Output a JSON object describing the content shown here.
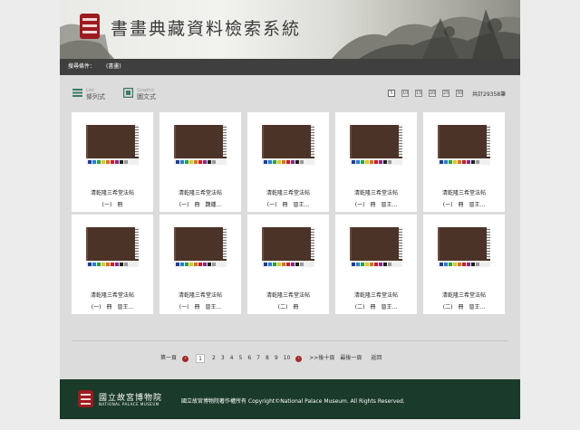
{
  "header": {
    "title": "書畫典藏資料檢索系統"
  },
  "search_condition": {
    "label": "搜尋條件：",
    "value": "(書畫)"
  },
  "toolbar": {
    "list_view": {
      "title": "List",
      "subtitle": "條列式"
    },
    "graphic_view": {
      "title": "Graphic",
      "subtitle": "圖文式"
    },
    "page_sizes": [
      "5",
      "10",
      "15",
      "20",
      "25",
      "30"
    ],
    "active_size": "5",
    "total": "共計29358筆"
  },
  "results": [
    {
      "title": "清乾隆三希堂法帖",
      "meta": [
        "(一)",
        "冊",
        ""
      ]
    },
    {
      "title": "清乾隆三希堂法帖",
      "meta": [
        "(一)",
        "冊",
        "魏鍾..."
      ]
    },
    {
      "title": "清乾隆三希堂法帖",
      "meta": [
        "(一)",
        "冊",
        "晉王..."
      ]
    },
    {
      "title": "清乾隆三希堂法帖",
      "meta": [
        "(一)",
        "冊",
        "晉王..."
      ]
    },
    {
      "title": "清乾隆三希堂法帖",
      "meta": [
        "(一)",
        "冊",
        "晉王..."
      ]
    },
    {
      "title": "清乾隆三希堂法帖",
      "meta": [
        "(一)",
        "冊",
        "晉王..."
      ]
    },
    {
      "title": "清乾隆三希堂法帖",
      "meta": [
        "(一)",
        "冊",
        "晉王..."
      ]
    },
    {
      "title": "清乾隆三希堂法帖",
      "meta": [
        "(二)",
        "冊",
        ""
      ]
    },
    {
      "title": "清乾隆三希堂法帖",
      "meta": [
        "(二)",
        "冊",
        "晉王..."
      ]
    },
    {
      "title": "清乾隆三希堂法帖",
      "meta": [
        "(二)",
        "冊",
        "晉王..."
      ]
    }
  ],
  "swatch_colors": [
    "#1f3f8f",
    "#2a7fd0",
    "#2aa14a",
    "#e6c61a",
    "#d9731c",
    "#c81f2a",
    "#8a2a8a",
    "#222222",
    "#999999"
  ],
  "pagination": {
    "first": "第一頁",
    "pages": [
      "1",
      "2",
      "3",
      "4",
      "5",
      "6",
      "7",
      "8",
      "9",
      "10"
    ],
    "current": "1",
    "next_ten": ">>後十頁",
    "last": "最後一頁",
    "back": "返回",
    "prev_icon": "‹",
    "next_icon": "›"
  },
  "footer": {
    "name_zh": "國立故宮博物院",
    "name_en": "NATIONAL PALACE MUSEUM",
    "copyright": "國立故宮博物院著作權所有 Copyright©National Palace Museum. All Rights Reserved."
  },
  "colors": {
    "accent": "#a0292c",
    "logo_red": "#9b1b20",
    "footer_bg": "#1a3a2a",
    "bar_bg": "#3f3f3f"
  }
}
